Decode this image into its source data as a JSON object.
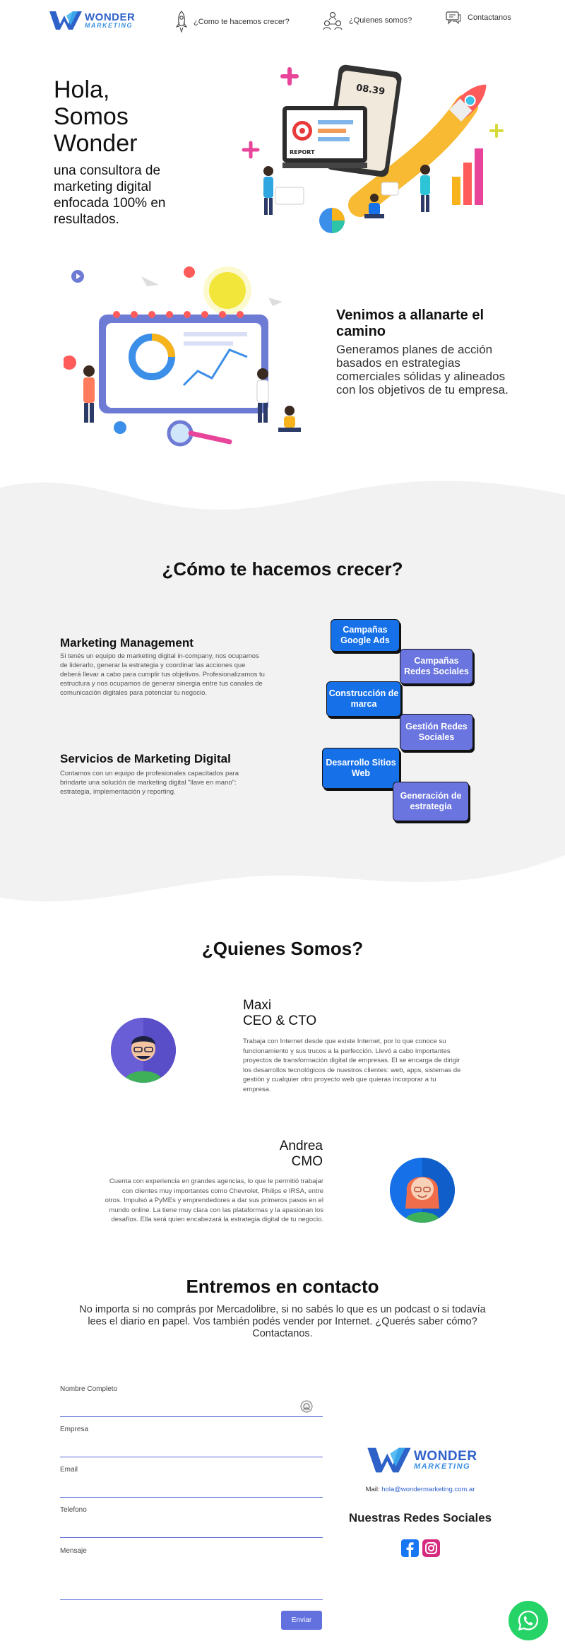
{
  "nav": {
    "logo_line1": "WONDER",
    "logo_line2": "MARKETING",
    "items": [
      {
        "label": "¿Como te hacemos crecer?",
        "icon": "rocket-icon"
      },
      {
        "label": "¿Quienes somos?",
        "icon": "team-icon"
      },
      {
        "label": "Contactanos",
        "icon": "chat-icon"
      }
    ]
  },
  "hero": {
    "title_line1": "Hola,",
    "title_line2": "Somos",
    "title_line3": "Wonder",
    "subtitle": "una consultora de marketing digital enfocada 100% en resultados.",
    "phone_time": "08.39",
    "report_label": "REPORT"
  },
  "intro": {
    "title": "Venimos a allanarte el camino",
    "text": "Generamos planes de acción basados en estrategias comerciales sólidas y alineados con los objetivos de tu empresa."
  },
  "services": {
    "title": "¿Cómo te hacemos crecer?",
    "items": [
      {
        "title": "Marketing Management",
        "text": "Si tenés un equipo de marketing digital in-company, nos ocupamos de liderarlo, generar la estrategia y coordinar las acciones que deberá llevar a cabo para cumplir tus objetivos. Profesionalizamos tu estructura y nos ocupamos de generar sinergia entre tus canales de comunicación digitales para potenciar tu negocio."
      },
      {
        "title": "Servicios de Marketing Digital",
        "text": "Contamos con un equipo de profesionales capacitados para brindarte una solución de marketing digital \"llave en mano\": estrategia, implementación y reporting."
      }
    ],
    "bubbles": [
      {
        "label": "Campañas Google Ads",
        "color": "blue"
      },
      {
        "label": "Campañas Redes Sociales",
        "color": "purple"
      },
      {
        "label": "Construcción de marca",
        "color": "blue"
      },
      {
        "label": "Gestión Redes Sociales",
        "color": "purple"
      },
      {
        "label": "Desarrollo Sitios Web",
        "color": "blue"
      },
      {
        "label": "Generación de estrategia",
        "color": "purple"
      }
    ]
  },
  "team": {
    "title": "¿Quienes Somos?",
    "members": [
      {
        "name": "Maxi",
        "role": "CEO & CTO",
        "bio": "Trabaja con Internet desde que existe Internet, por lo que conoce su funcionamiento y sus trucos a la perfección. Llevó a cabo importantes proyectos de transformación digital de empresas. El se encarga de dirigir los desarrollos tecnológicos de nuestros clientes: web, apps, sistemas de gestión y cualquier otro proyecto web que quieras incorporar a tu empresa."
      },
      {
        "name": "Andrea",
        "role": "CMO",
        "bio": "Cuenta con experiencia en grandes agencias, lo que le permitió trabajar con clientes muy importantes como Chevrolet, Philips e IRSA, entre otros. Impulsó a PyMEs y emprendedores a dar sus primeros pasos en el mundo online. La tiene muy clara con las plataformas y la apasionan los desafíos. Ella será quien encabezará la estrategia digital de tu negocio."
      }
    ]
  },
  "contact": {
    "title": "Entremos en contacto",
    "intro": "No importa si no comprás por Mercadolibre, si no sabés lo que es un podcast o si todavía lees el diario en papel. Vos también podés vender por Internet. ¿Querés saber cómo? Contactanos.",
    "fields": {
      "name": "Nombre Completo",
      "company": "Empresa",
      "email": "Email",
      "phone": "Telefono",
      "message": "Mensaje"
    },
    "submit": "Enviar",
    "mail_label": "Mail:",
    "mail": "hola@wondermarketing.com.ar",
    "social_title": "Nuestras Redes Sociales"
  },
  "colors": {
    "primary_blue": "#1670e8",
    "purple": "#6a75df",
    "logo_blue": "#2f62c9",
    "whatsapp": "#25d366",
    "section_grey": "#f2f2f3"
  }
}
